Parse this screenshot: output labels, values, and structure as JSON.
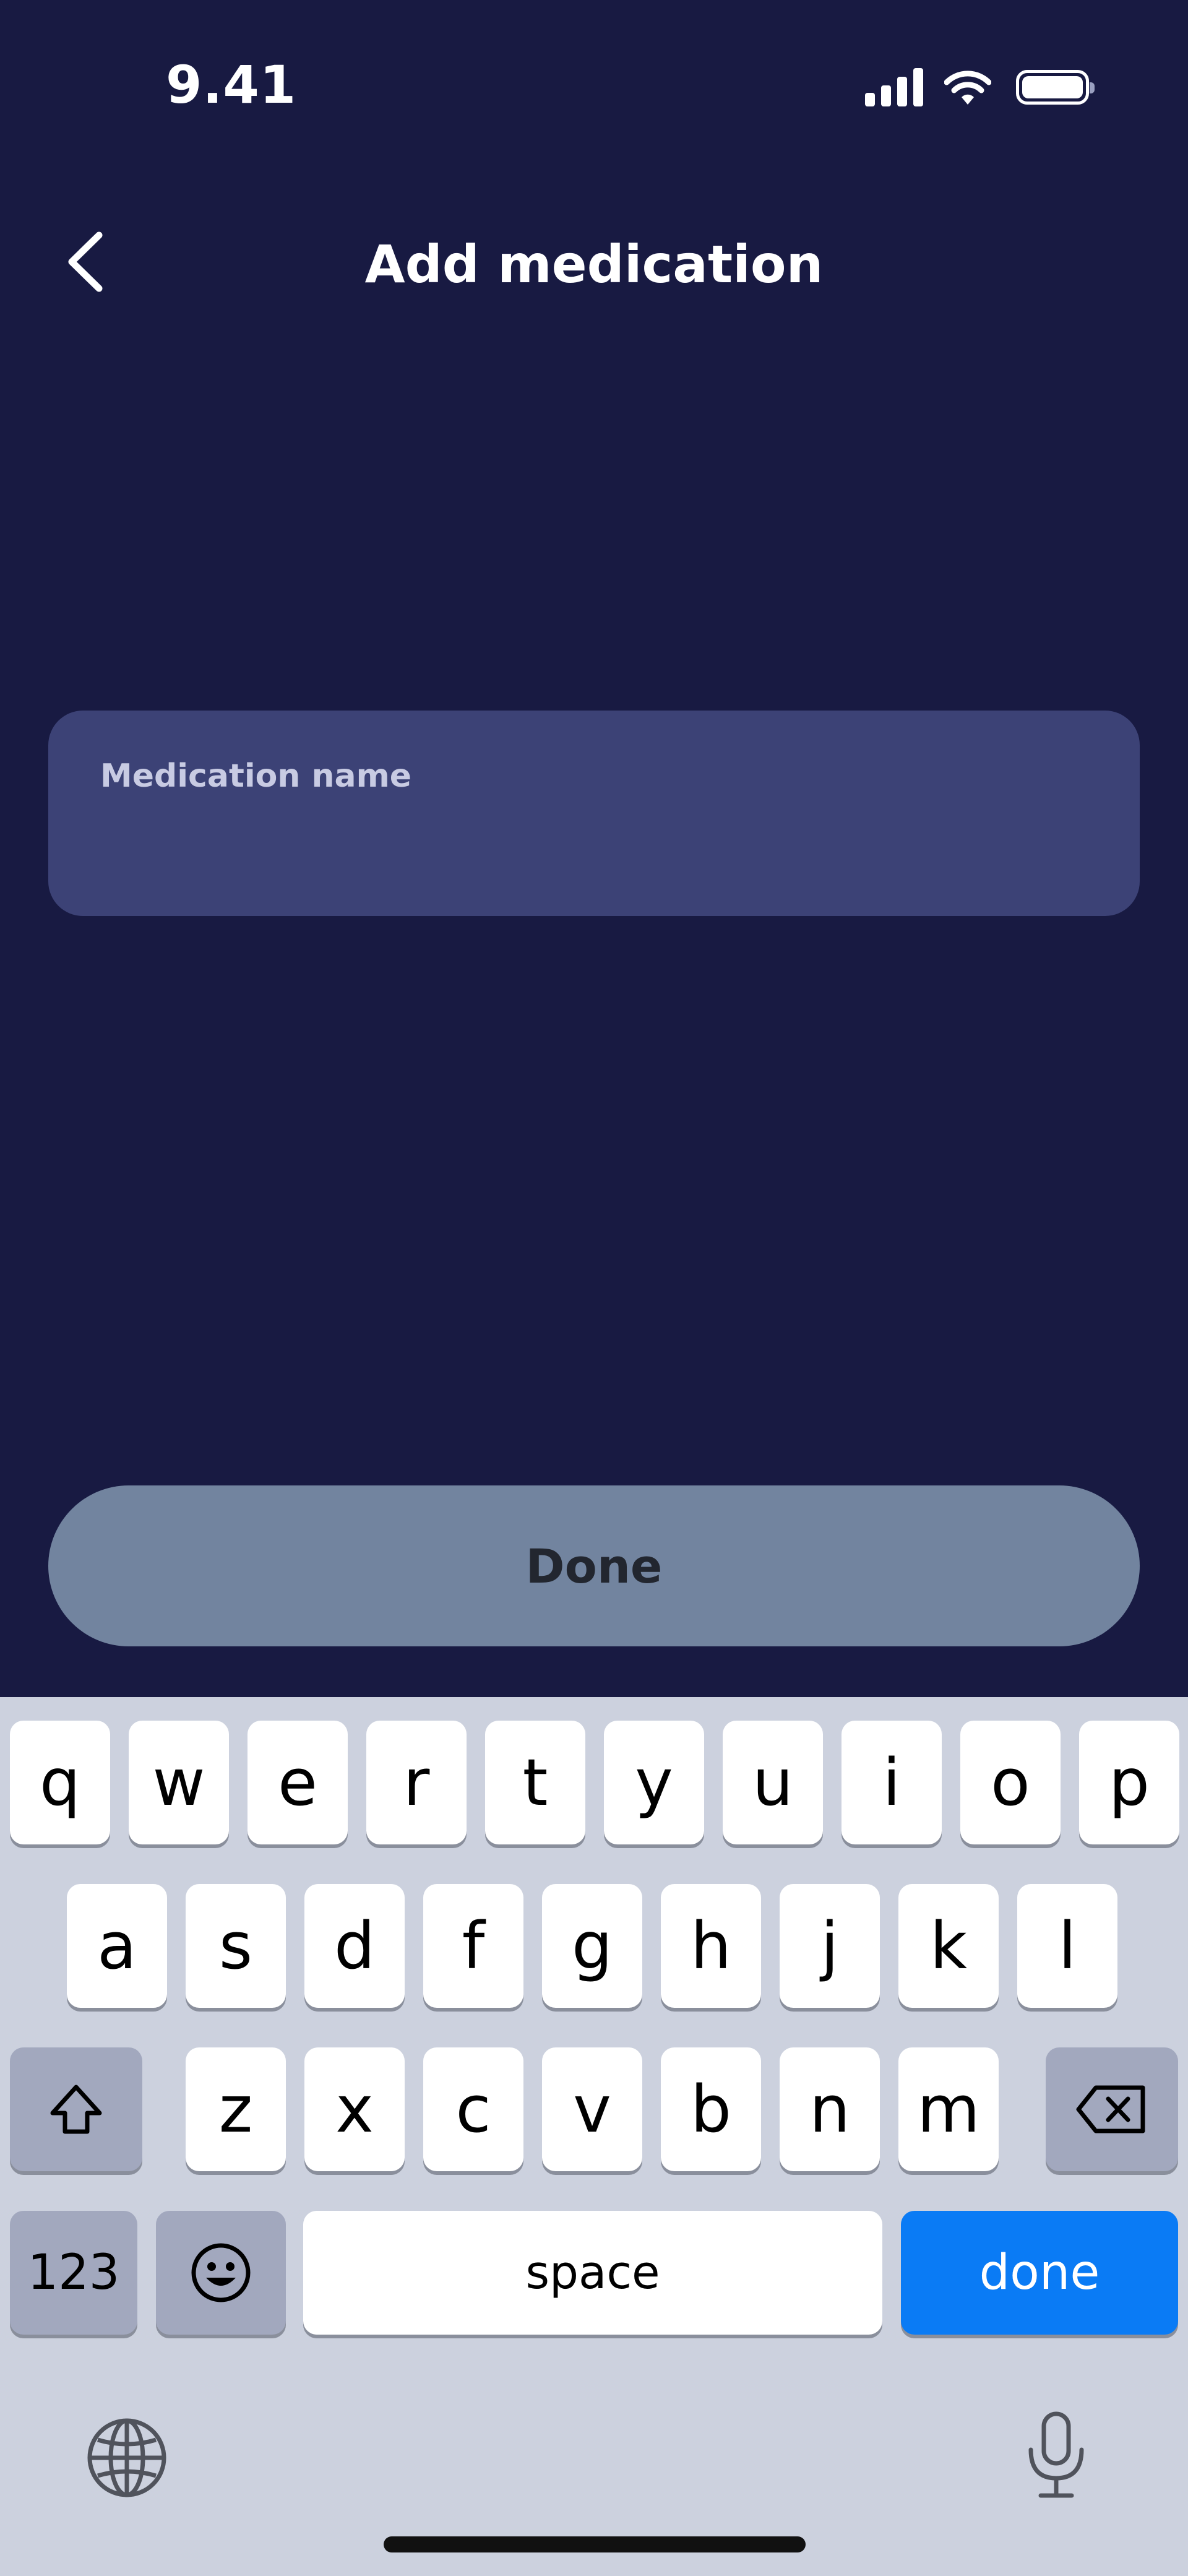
{
  "status_bar": {
    "time": "9.41",
    "icons": [
      "cellular-signal-icon",
      "wifi-icon",
      "battery-icon"
    ]
  },
  "header": {
    "back_icon": "chevron-left-icon",
    "title": "Add medication"
  },
  "form": {
    "medication_name_label": "Medication name",
    "medication_name_value": ""
  },
  "done_button": {
    "label": "Done"
  },
  "keyboard": {
    "row1": [
      "q",
      "w",
      "e",
      "r",
      "t",
      "y",
      "u",
      "i",
      "o",
      "p"
    ],
    "row2": [
      "a",
      "s",
      "d",
      "f",
      "g",
      "h",
      "j",
      "k",
      "l"
    ],
    "row3": [
      "z",
      "x",
      "c",
      "v",
      "b",
      "n",
      "m"
    ],
    "numbers_label": "123",
    "space_label": "space",
    "done_label": "done",
    "icons": [
      "shift-icon",
      "backspace-icon",
      "emoji-icon",
      "globe-icon",
      "microphone-icon"
    ]
  },
  "colors": {
    "background": "#181a42",
    "field": "#3c4276",
    "done_button": "#72849f",
    "keyboard_bg": "#ccd1de",
    "keyboard_done": "#0a7bf5"
  }
}
